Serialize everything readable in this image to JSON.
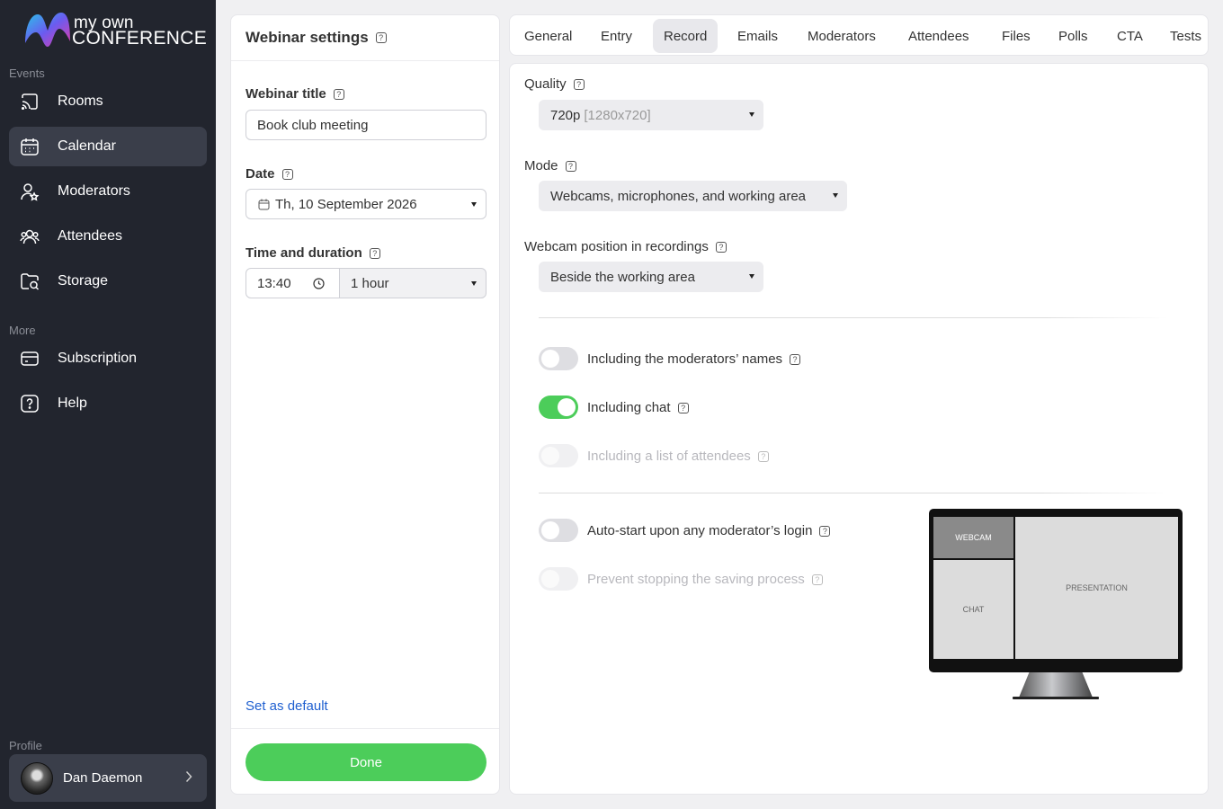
{
  "brand": {
    "line1": "my own",
    "line2": "CONFERENCE"
  },
  "sidebar": {
    "events_label": "Events",
    "more_label": "More",
    "profile_label": "Profile",
    "items": [
      {
        "label": "Rooms",
        "icon": "cast-icon"
      },
      {
        "label": "Calendar",
        "icon": "calendar-icon",
        "active": true
      },
      {
        "label": "Moderators",
        "icon": "user-star-icon"
      },
      {
        "label": "Attendees",
        "icon": "users-icon"
      },
      {
        "label": "Storage",
        "icon": "folder-search-icon"
      },
      {
        "label": "Subscription",
        "icon": "card-icon"
      },
      {
        "label": "Help",
        "icon": "question-icon"
      }
    ],
    "profile": {
      "name": "Dan Daemon"
    }
  },
  "settings": {
    "title": "Webinar settings",
    "webinar_title_label": "Webinar title",
    "webinar_title_value": "Book club meeting",
    "date_label": "Date",
    "date_value": "Th, 10 September 2026",
    "time_label": "Time and duration",
    "time_value": "13:40",
    "duration_value": "1 hour",
    "set_default": "Set as default",
    "done": "Done"
  },
  "tabs": [
    "General",
    "Entry",
    "Record",
    "Emails",
    "Moderators",
    "Attendees",
    "Files",
    "Polls",
    "CTA",
    "Tests"
  ],
  "active_tab": "Record",
  "record": {
    "quality_label": "Quality",
    "quality_value": "720p",
    "quality_detail": "[1280x720]",
    "mode_label": "Mode",
    "mode_value": "Webcams, microphones, and working area",
    "webcam_position_label": "Webcam position in recordings",
    "webcam_position_value": "Beside the working area",
    "toggles": [
      {
        "label": "Including the moderators’ names",
        "state": "off"
      },
      {
        "label": "Including chat",
        "state": "on"
      },
      {
        "label": "Including a list of attendees",
        "state": "disabled"
      },
      {
        "label": "Auto-start upon any moderator’s login",
        "state": "off"
      },
      {
        "label": "Prevent stopping the saving process",
        "state": "disabled"
      }
    ],
    "preview": {
      "webcam": "WEBCAM",
      "chat": "CHAT",
      "presentation": "PRESENTATION"
    }
  },
  "colors": {
    "sidebar": "#22252e",
    "accent_green": "#4ccd5a",
    "link_blue": "#1e5fd0"
  }
}
